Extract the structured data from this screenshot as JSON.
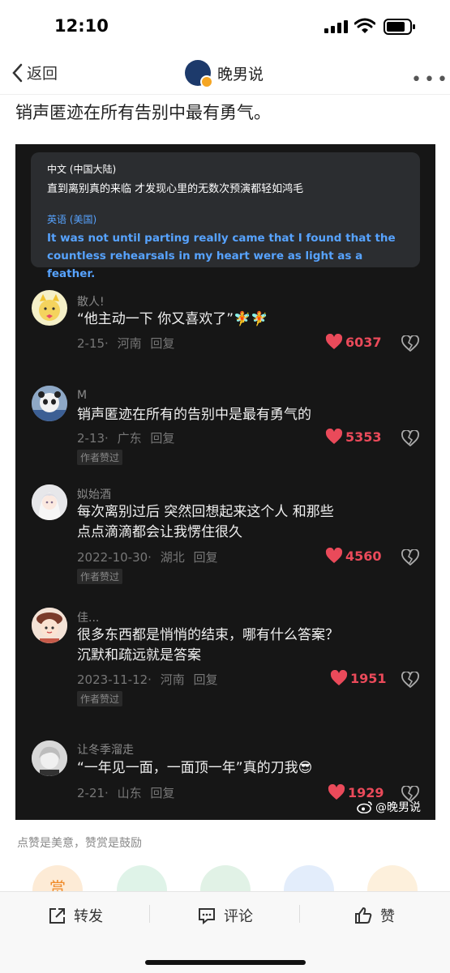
{
  "status": {
    "time": "12:10"
  },
  "nav": {
    "back_label": "返回",
    "title": "晚男说"
  },
  "post": {
    "headline": "销声匿迹在所有告别中最有勇气。"
  },
  "subtitle": {
    "lang1": "中文 (中国大陆)",
    "text_zh": "直到离别真的来临  才发现心里的无数次预演都轻如鸿毛",
    "lang2": "英语 (美国)",
    "text_en": "It was not until parting really came that I found that the countless rehearsals in my heart were as light as a feather."
  },
  "comments": [
    {
      "name": "散人!",
      "text": "“他主动一下 你又喜欢了”🧚🧚",
      "meta": "2-15· 河南  回复",
      "likes": "6037",
      "badge": ""
    },
    {
      "name": "M",
      "text": "销声匿迹在所有的告别中是最有勇气的",
      "meta": "2-13· 广东  回复",
      "likes": "5353",
      "badge": "作者赞过"
    },
    {
      "name": "姒始酒",
      "text": "每次离别过后 突然回想起来这个人 和那些点点滴滴都会让我愣住很久",
      "meta": "2022-10-30· 湖北  回复",
      "likes": "4560",
      "badge": "作者赞过"
    },
    {
      "name": "佳...",
      "text": "很多东西都是悄悄的结束，哪有什么答案？沉默和疏远就是答案",
      "meta": "2023-11-12· 河南  回复",
      "likes": "1951",
      "badge": "作者赞过"
    },
    {
      "name": "让冬季溜走",
      "text": "“一年见一面，一面顶一年”真的刀我😎",
      "meta": "2-21· 山东  回复",
      "likes": "1929",
      "badge": ""
    }
  ],
  "watermark": "@晚男说",
  "caption": "点赞是美意，赞赏是鼓励",
  "reward_first": "赏",
  "actions": {
    "share": "转发",
    "comment": "评论",
    "like": "赞"
  },
  "colors": {
    "like_red": "#ea4a5a",
    "subtitle_blue": "#57a3ff",
    "video_bg": "#161616"
  }
}
